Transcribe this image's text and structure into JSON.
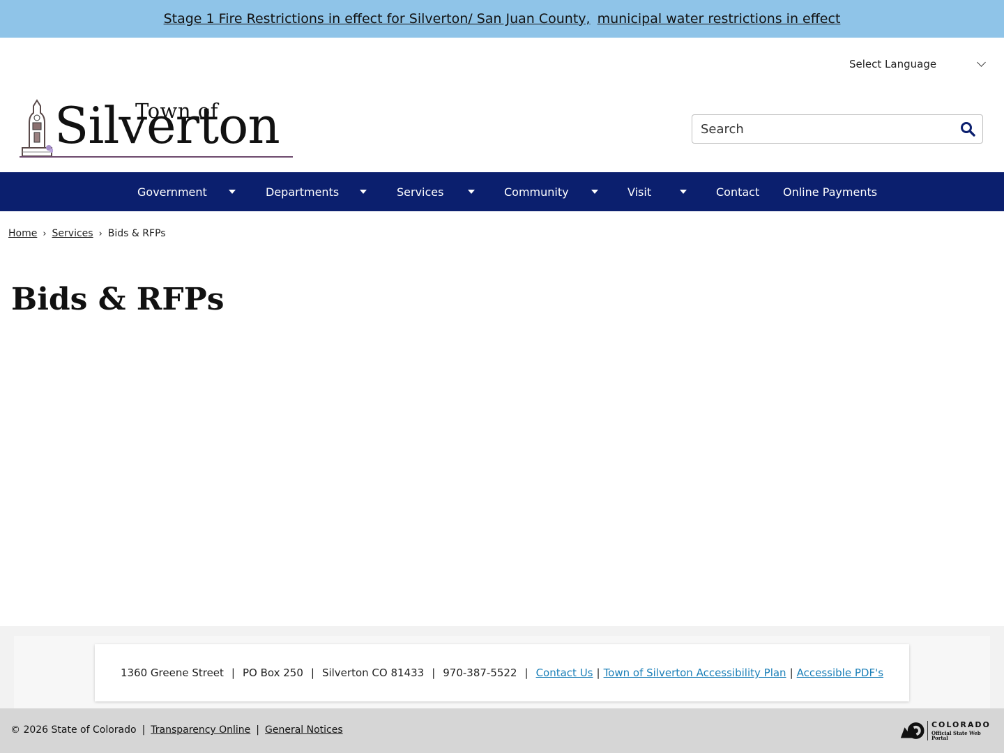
{
  "alert": {
    "link1": "Stage 1 Fire Restrictions in effect for Silverton/ San Juan County,",
    "link2": "municipal water restrictions in effect"
  },
  "language": {
    "label": "Select Language"
  },
  "logo": {
    "town_of": "Town of",
    "name": "Silverton"
  },
  "search": {
    "placeholder": "Search"
  },
  "nav": {
    "items": [
      {
        "label": "Government",
        "has_dropdown": true
      },
      {
        "label": "Departments",
        "has_dropdown": true
      },
      {
        "label": "Services",
        "has_dropdown": true
      },
      {
        "label": "Community",
        "has_dropdown": true
      },
      {
        "label": "Visit",
        "has_dropdown": true
      },
      {
        "label": "Contact",
        "has_dropdown": false
      },
      {
        "label": "Online Payments",
        "has_dropdown": false
      }
    ]
  },
  "breadcrumb": {
    "home": "Home",
    "services": "Services",
    "current": "Bids & RFPs",
    "separator": "›"
  },
  "page": {
    "title": "Bids & RFPs"
  },
  "footer": {
    "address": "1360 Greene Street",
    "po_box": "PO Box 250",
    "city": "Silverton CO 81433",
    "phone": "970-387-5522",
    "contact_link": "Contact Us",
    "accessibility_link": "Town of Silverton Accessibility Plan",
    "pdf_link": "Accessible PDF's",
    "separator": "|"
  },
  "bottom": {
    "copyright": "© 2026 State of Colorado",
    "transparency": "Transparency Online",
    "notices": "General Notices",
    "separator": "|",
    "colorado_logo": {
      "title": "COLORADO",
      "subtitle": "Official State Web Portal"
    }
  },
  "colors": {
    "alert_bg": "#8fc4e8",
    "nav_bg": "#0b1f6e",
    "link": "#1a7fb8",
    "footer_bg": "#f2f2f2",
    "bottom_bg": "#d6d6d6"
  },
  "icons": {
    "search": "search-icon",
    "language_dropdown": "chevron-down-icon",
    "nav_dropdown": "caret-down-icon"
  }
}
